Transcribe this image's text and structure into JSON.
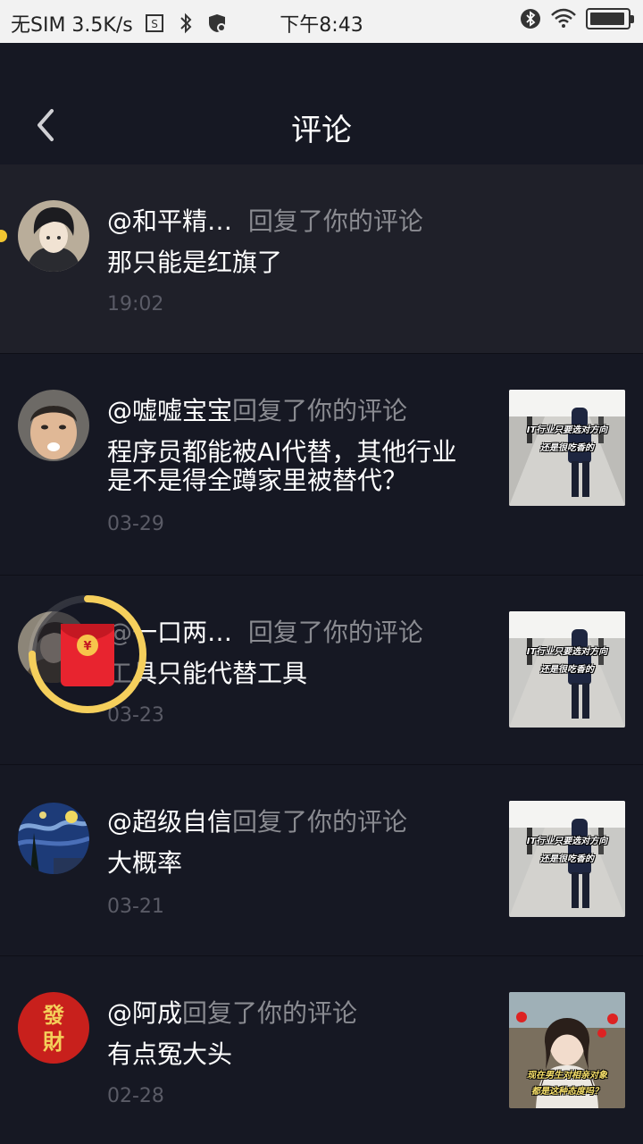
{
  "status_bar": {
    "carrier": "无SIM 3.5K/s",
    "time": "下午8:43",
    "battery_level": 0.95,
    "icons": [
      "sim-settings-icon",
      "bluetooth-icon",
      "shield-icon",
      "bluetooth-icon",
      "wifi-icon",
      "battery-icon"
    ]
  },
  "header": {
    "title": "评论",
    "back_icon": "chevron-left-icon"
  },
  "comments": [
    {
      "user": "@和平精…",
      "action": "回复了你的评论",
      "text": "那只能是红旗了",
      "time": "19:02",
      "unread": true,
      "avatar": "anime-boy",
      "has_thumb": false
    },
    {
      "user": "@嘘嘘宝宝",
      "action": "回复了你的评论",
      "text": "程序员都能被AI代替，其他行业是不是得全蹲家里被替代？",
      "time": "03-29",
      "avatar": "kid-face",
      "has_thumb": true,
      "thumb_caption": [
        "IT行业只要选对方向",
        "还是很吃香的"
      ]
    },
    {
      "user": "@一口两…",
      "action": "回复了你的评论",
      "text": "工具只能代替工具",
      "time": "03-23",
      "avatar": "anime-soldier",
      "has_thumb": true,
      "thumb_caption": [
        "IT行业只要选对方向",
        "还是很吃香的"
      ]
    },
    {
      "user": "@超级自信",
      "action": "回复了你的评论",
      "text": "大概率",
      "time": "03-21",
      "avatar": "starry-night",
      "has_thumb": true,
      "thumb_caption": [
        "IT行业只要选对方向",
        "还是很吃香的"
      ]
    },
    {
      "user": "@阿成",
      "action": "回复了你的评论",
      "text": "有点冤大头",
      "time": "02-28",
      "avatar": "fortune-seal",
      "avatar_text": [
        "發",
        "財"
      ],
      "has_thumb": true,
      "thumb_caption": [
        "现在男生对相亲对象",
        "都是这种态度吗？"
      ]
    }
  ],
  "red_packet": {
    "symbol": "¥",
    "progress": 0.75,
    "icon": "red-envelope-icon"
  },
  "colors": {
    "background": "#161823",
    "highlight_row": "#1f2029",
    "unread_dot": "#f2c531",
    "muted_text": "#8a8b91",
    "time_text": "#5a5b66"
  }
}
